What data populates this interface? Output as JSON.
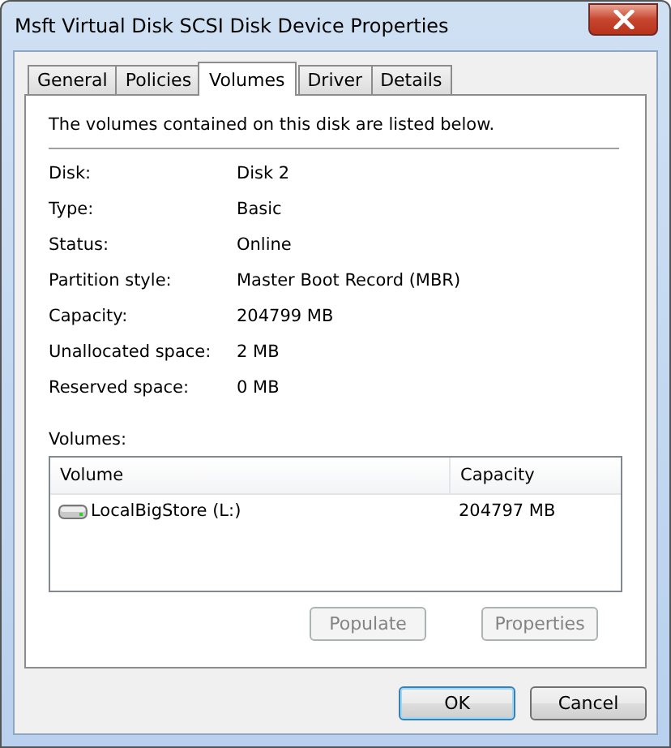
{
  "window": {
    "title": "Msft Virtual Disk SCSI Disk Device Properties"
  },
  "tabs": [
    {
      "label": "General",
      "selected": false
    },
    {
      "label": "Policies",
      "selected": false
    },
    {
      "label": "Volumes",
      "selected": true
    },
    {
      "label": "Driver",
      "selected": false
    },
    {
      "label": "Details",
      "selected": false
    }
  ],
  "intro": "The volumes contained on this disk are listed below.",
  "properties": [
    {
      "label": "Disk:",
      "value": "Disk 2"
    },
    {
      "label": "Type:",
      "value": "Basic"
    },
    {
      "label": "Status:",
      "value": "Online"
    },
    {
      "label": "Partition style:",
      "value": "Master Boot Record (MBR)"
    },
    {
      "label": "Capacity:",
      "value": "204799 MB"
    },
    {
      "label": "Unallocated space:",
      "value": "2 MB"
    },
    {
      "label": "Reserved space:",
      "value": "0 MB"
    }
  ],
  "volumes": {
    "label": "Volumes:",
    "columns": [
      "Volume",
      "Capacity"
    ],
    "rows": [
      {
        "volume": "LocalBigStore (L:)",
        "capacity": "204797 MB"
      }
    ]
  },
  "panel_buttons": [
    {
      "label": "Populate",
      "disabled": true
    },
    {
      "label": "Properties",
      "disabled": true
    }
  ],
  "dialog_buttons": [
    {
      "label": "OK",
      "default": true
    },
    {
      "label": "Cancel",
      "default": false
    }
  ]
}
